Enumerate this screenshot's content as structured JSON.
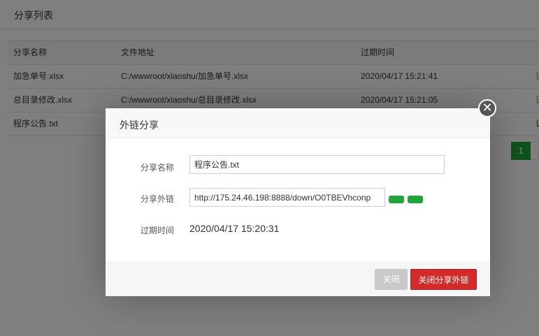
{
  "page": {
    "title": "分享列表",
    "table": {
      "headers": {
        "name": "分享名称",
        "path": "文件地址",
        "expire": "过期时间"
      },
      "rows": [
        {
          "name": "加急单号.xlsx",
          "path": "C:/wwwroot/xiaoshu/加急单号.xlsx",
          "expire": "2020/04/17 15:21:41",
          "op": "详"
        },
        {
          "name": "总目录修改.xlsx",
          "path": "C:/wwwroot/xiaoshu/总目录修改.xlsx",
          "expire": "2020/04/17 15:21:05",
          "op": "详"
        },
        {
          "name": "程序公告.txt",
          "path": "",
          "expire": "",
          "op": "详"
        }
      ]
    },
    "pager": {
      "current": "1"
    }
  },
  "dialog": {
    "title": "外链分享",
    "close_glyph": "✕",
    "name_label": "分享名称",
    "name_value": "程序公告.txt",
    "link_label": "分享外链",
    "link_value": "http://175.24.46.198:8888/down/O0TBEVhconp",
    "expire_label": "过期时间",
    "expire_value": "2020/04/17 15:20:31",
    "buttons": {
      "close": "关闭",
      "close_share": "关闭分享外链"
    }
  },
  "colors": {
    "accent": "#20a53a",
    "danger": "#d52a2a",
    "overlay": "rgba(0,0,0,0.5)"
  }
}
